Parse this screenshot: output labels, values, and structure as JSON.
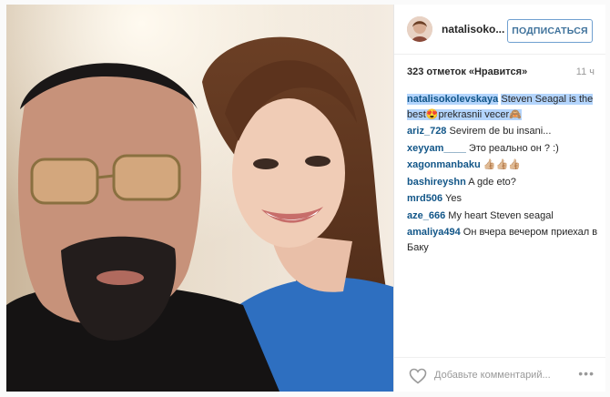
{
  "post": {
    "username": "natalisokо...",
    "follow_label": "ПОДПИСАТЬСЯ",
    "likes_label": "323 отметок «Нравится»",
    "time_label": "11 ч",
    "comments": [
      {
        "user": "natalisokolevskaya",
        "text": "Steven Seagal is the best😍prekrasnii vecer🙈"
      },
      {
        "user": "ariz_728",
        "text": "Sevirem de bu insani..."
      },
      {
        "user": "xeyyam____",
        "text": "Это реально он ? :)"
      },
      {
        "user": "xagonmanbaku",
        "text": "👍🏼👍🏼👍🏼"
      },
      {
        "user": "bashireyshn",
        "text": "A gde eto?"
      },
      {
        "user": "mrd506",
        "text": "Yes"
      },
      {
        "user": "aze_666",
        "text": "My heart Steven seagal"
      },
      {
        "user": "amaliya494",
        "text": "Он вчера вечером приехал в Баку"
      }
    ],
    "add_comment_placeholder": "Добавьте комментарий...",
    "more_label": "•••"
  },
  "icons": {
    "heart": "heart-outline-icon",
    "more": "ellipsis-icon"
  },
  "colors": {
    "username_link": "#125688",
    "follow_border": "#70a0d0",
    "selection_highlight": "#b3d4fc"
  }
}
